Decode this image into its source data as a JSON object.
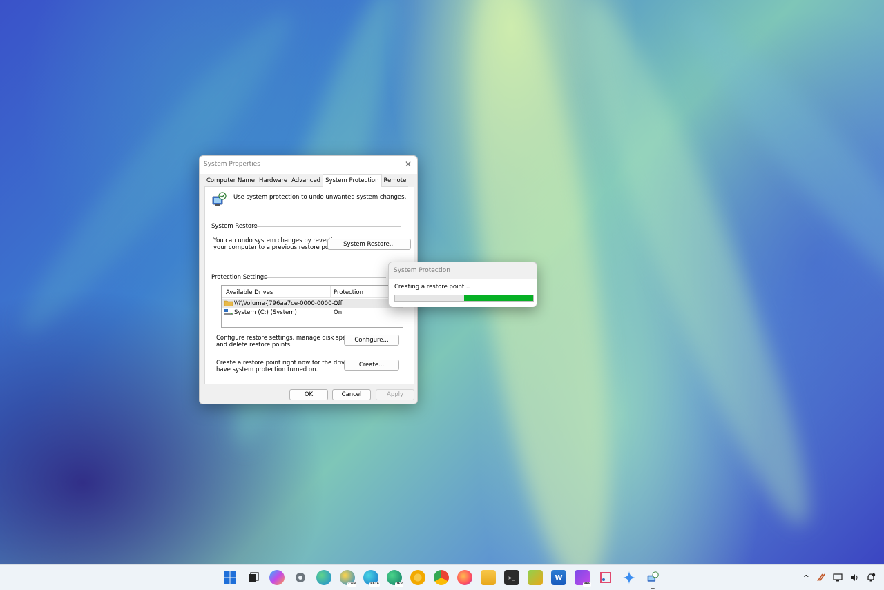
{
  "dialog": {
    "title": "System Properties",
    "close_glyph": "✕",
    "tabs": [
      {
        "label": "Computer Name"
      },
      {
        "label": "Hardware"
      },
      {
        "label": "Advanced"
      },
      {
        "label": "System Protection"
      },
      {
        "label": "Remote"
      }
    ],
    "active_tab": "System Protection",
    "lead_text": "Use system protection to undo unwanted system changes.",
    "system_restore": {
      "group_label": "System Restore",
      "description_line1": "You can undo system changes by reverting",
      "description_line2": "your computer to a previous restore point.",
      "button_label": "System Restore..."
    },
    "protection_settings": {
      "group_label": "Protection Settings",
      "columns": [
        "Available Drives",
        "Protection"
      ],
      "drives": [
        {
          "name": "\\\\?\\Volume{796aa7ce-0000-0000-...",
          "protection": "Off",
          "selected": true
        },
        {
          "name": "System (C:) (System)",
          "protection": "On",
          "selected": false
        }
      ],
      "configure_line1": "Configure restore settings, manage disk space,",
      "configure_line2": "and delete restore points.",
      "configure_button": "Configure...",
      "create_line1": "Create a restore point right now for the drives that",
      "create_line2": "have system protection turned on.",
      "create_button": "Create..."
    },
    "footer": {
      "ok": "OK",
      "cancel": "Cancel",
      "apply": "Apply"
    }
  },
  "progress_popup": {
    "title": "System Protection",
    "message": "Creating a restore point...",
    "indeterminate_segment": {
      "start_fraction": 0.5,
      "end_fraction": 1.0
    },
    "bar_color": "#06b025"
  },
  "taskbar": {
    "apps": [
      {
        "name": "start-icon",
        "badge": ""
      },
      {
        "name": "task-view-icon",
        "badge": ""
      },
      {
        "name": "copilot-icon",
        "badge": ""
      },
      {
        "name": "settings-icon",
        "badge": ""
      },
      {
        "name": "edge-icon",
        "badge": ""
      },
      {
        "name": "edge-canary-icon",
        "badge": "CAN"
      },
      {
        "name": "edge-beta-icon",
        "badge": "BETA"
      },
      {
        "name": "edge-dev-icon",
        "badge": "DEV"
      },
      {
        "name": "chrome-canary-icon",
        "badge": ""
      },
      {
        "name": "chrome-icon",
        "badge": ""
      },
      {
        "name": "firefox-icon",
        "badge": ""
      },
      {
        "name": "file-explorer-icon",
        "badge": ""
      },
      {
        "name": "terminal-icon",
        "badge": ""
      },
      {
        "name": "notepad-plus-icon",
        "badge": ""
      },
      {
        "name": "word-icon",
        "badge": ""
      },
      {
        "name": "dev-home-icon",
        "badge": "PRE"
      },
      {
        "name": "snipping-tool-icon",
        "badge": ""
      },
      {
        "name": "gemini-icon",
        "badge": ""
      },
      {
        "name": "system-properties-icon",
        "badge": ""
      }
    ],
    "tray": {
      "chevron": "^",
      "icons": [
        "pen-icon",
        "display-icon",
        "volume-icon",
        "notification-icon"
      ]
    }
  },
  "colors": {
    "accent_green": "#06b025",
    "dialog_bg": "#f0f0f0",
    "taskbar_bg": "#eef3f8"
  }
}
